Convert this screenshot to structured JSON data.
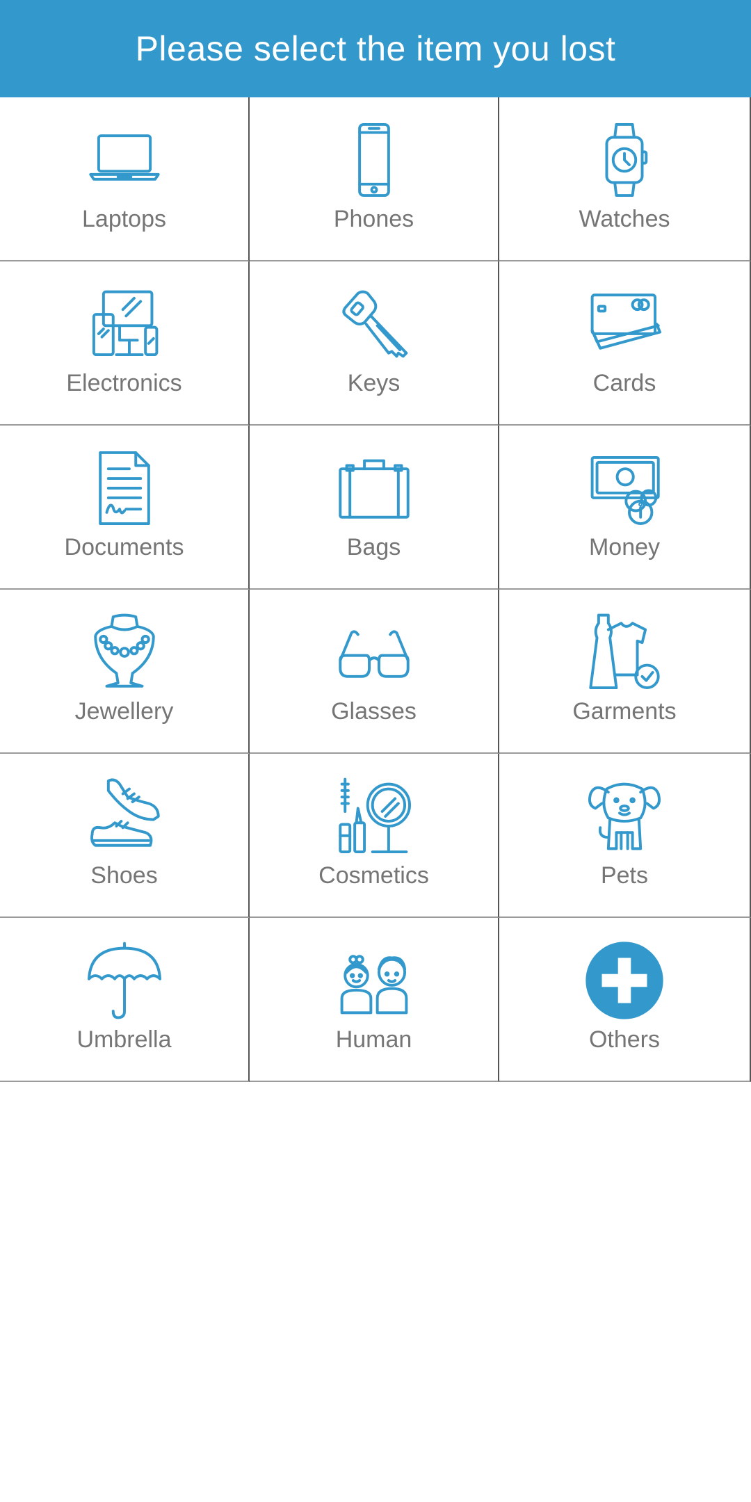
{
  "header": {
    "title": "Please select the item you lost",
    "background_color": "#3399cc",
    "text_color": "#ffffff"
  },
  "theme": {
    "icon_color": "#3399cc",
    "label_color": "#757575"
  },
  "items": [
    {
      "label": "Laptops",
      "icon": "laptop-icon"
    },
    {
      "label": "Phones",
      "icon": "phone-icon"
    },
    {
      "label": "Watches",
      "icon": "watch-icon"
    },
    {
      "label": "Electronics",
      "icon": "electronics-icon"
    },
    {
      "label": "Keys",
      "icon": "key-icon"
    },
    {
      "label": "Cards",
      "icon": "cards-icon"
    },
    {
      "label": "Documents",
      "icon": "document-icon"
    },
    {
      "label": "Bags",
      "icon": "bag-icon"
    },
    {
      "label": "Money",
      "icon": "money-icon"
    },
    {
      "label": "Jewellery",
      "icon": "jewellery-icon"
    },
    {
      "label": "Glasses",
      "icon": "glasses-icon"
    },
    {
      "label": "Garments",
      "icon": "garments-icon"
    },
    {
      "label": "Shoes",
      "icon": "shoes-icon"
    },
    {
      "label": "Cosmetics",
      "icon": "cosmetics-icon"
    },
    {
      "label": "Pets",
      "icon": "pet-icon"
    },
    {
      "label": "Umbrella",
      "icon": "umbrella-icon"
    },
    {
      "label": "Human",
      "icon": "human-icon"
    },
    {
      "label": "Others",
      "icon": "plus-circle-icon"
    }
  ]
}
